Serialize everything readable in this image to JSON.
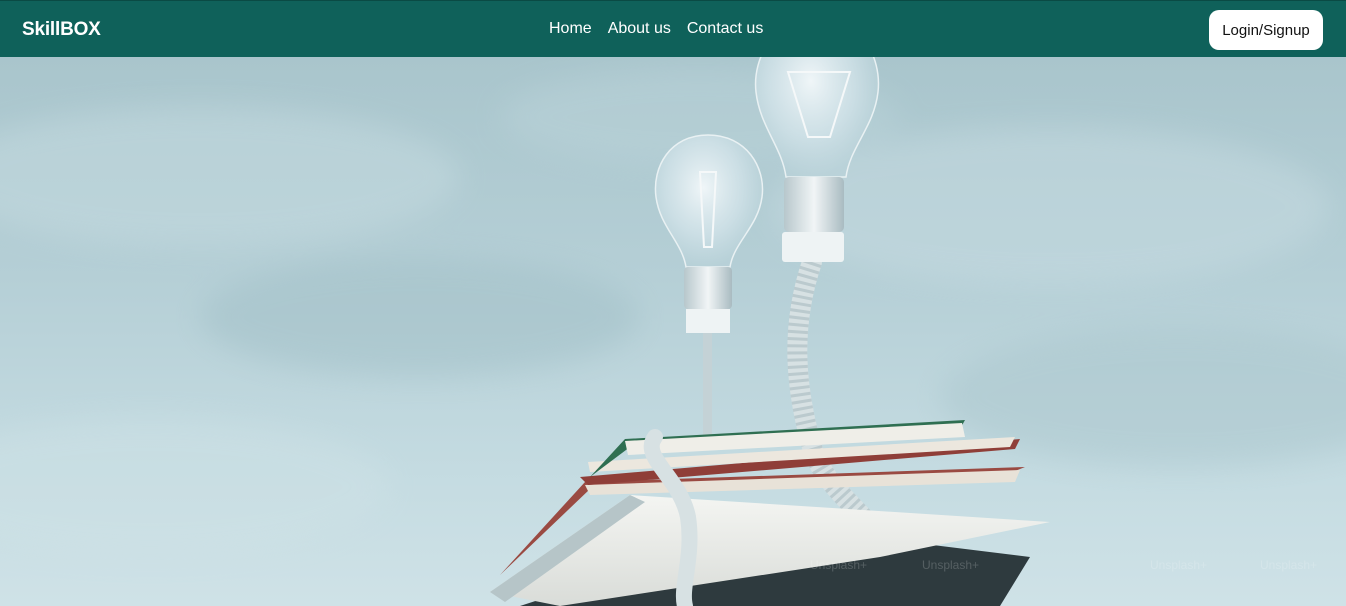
{
  "brand": {
    "name": "SkillBOX"
  },
  "nav": {
    "links": [
      {
        "label": "Home"
      },
      {
        "label": "About us"
      },
      {
        "label": "Contact us"
      }
    ],
    "login_label": "Login/Signup"
  },
  "colors": {
    "navbar": "#0f615a",
    "nav_text": "#ffffff",
    "button_bg": "#ffffff",
    "hero_sky": "#b5cfd6"
  },
  "hero": {
    "image_subject": "light bulbs on stack of books",
    "watermark_text": "Unsplash+"
  }
}
